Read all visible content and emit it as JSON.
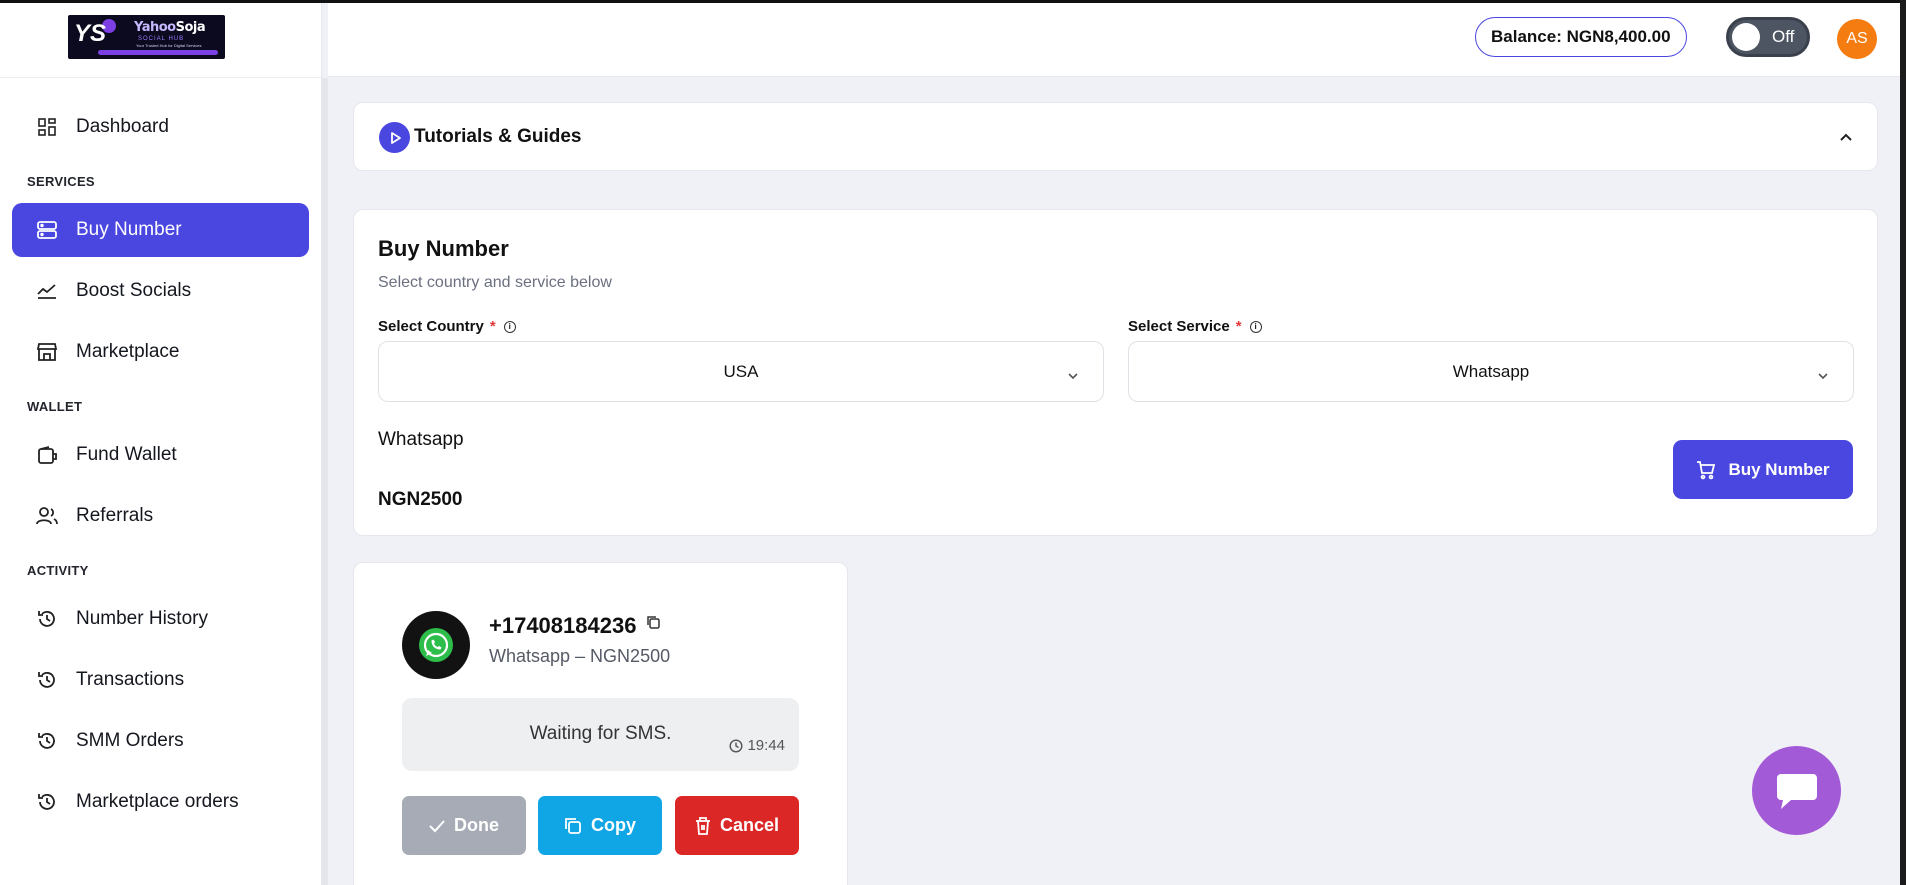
{
  "app": {
    "logo_alt": "Yahoo Soja Social Hub"
  },
  "logo": {
    "brand_left": "Yahoo",
    "brand_right": "Soja",
    "tagline": "SOCIAL HUB",
    "mini": "Your Trusted Hub for Digital Services"
  },
  "header": {
    "balance_label": "Balance: NGN8,400.00",
    "toggle_label": "Off",
    "avatar_initials": "AS"
  },
  "sidebar": {
    "dashboard": "Dashboard",
    "section_services": "SERVICES",
    "buy_number": "Buy Number",
    "boost_socials": "Boost Socials",
    "marketplace": "Marketplace",
    "section_wallet": "WALLET",
    "fund_wallet": "Fund Wallet",
    "referrals": "Referrals",
    "section_activity": "ACTIVITY",
    "number_history": "Number History",
    "transactions": "Transactions",
    "smm_orders": "SMM Orders",
    "marketplace_orders": "Marketplace orders"
  },
  "tutorials": {
    "title": "Tutorials & Guides"
  },
  "buy": {
    "title": "Buy Number",
    "subtitle": "Select country and service below",
    "country_label": "Select Country",
    "country_value": "USA",
    "service_label": "Select Service",
    "service_value": "Whatsapp",
    "required_mark": "*",
    "selected_service": "Whatsapp",
    "price": "NGN2500",
    "button_label": "Buy Number"
  },
  "number_card": {
    "number": "+17408184236",
    "subtitle": "Whatsapp – NGN2500",
    "status": "Waiting for SMS.",
    "time": "19:44",
    "done_label": "Done",
    "copy_label": "Copy",
    "cancel_label": "Cancel"
  },
  "colors": {
    "accent": "#4a46e0",
    "copy": "#10a5e5",
    "cancel": "#dc2727",
    "done": "#a6abb6",
    "avatar": "#f47c10",
    "chat": "#a35ad6"
  },
  "icons": {
    "dashboard": "grid-icon",
    "buy_number": "server-icon",
    "boost_socials": "trend-icon",
    "marketplace": "store-icon",
    "fund_wallet": "wallet-icon",
    "referrals": "users-icon",
    "history": "history-icon"
  }
}
